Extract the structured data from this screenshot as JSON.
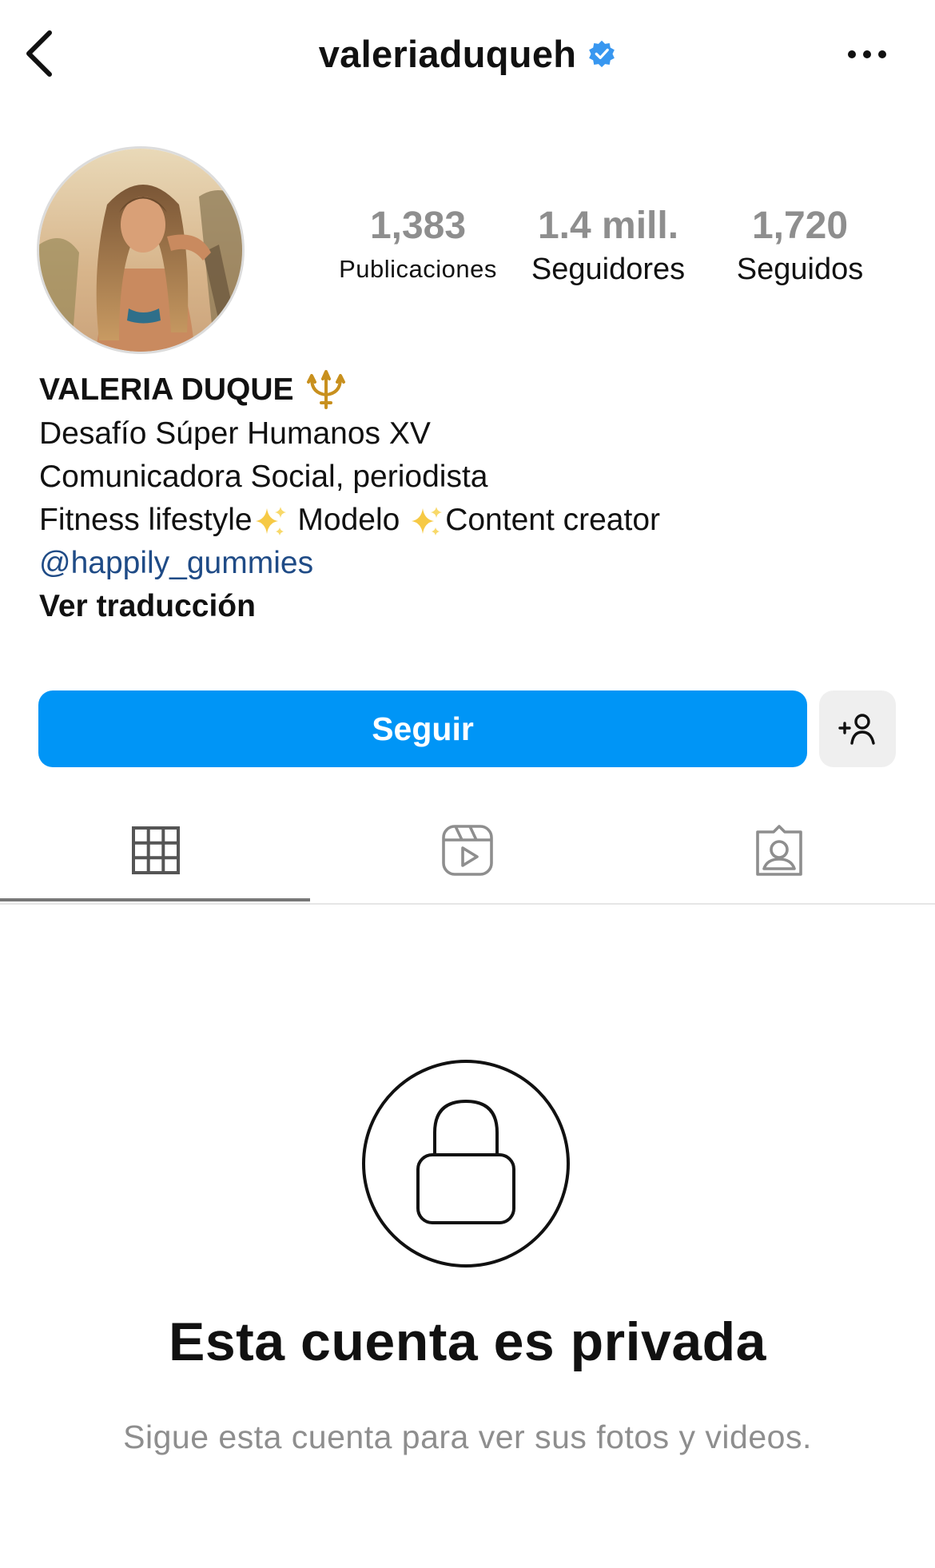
{
  "header": {
    "username": "valeriaduqueh",
    "back_icon": "chevron-left-icon",
    "verified_icon": "verified-badge-icon",
    "more_icon": "more-dots-icon"
  },
  "stats": {
    "posts": {
      "value": "1,383",
      "label": "Publicaciones"
    },
    "followers": {
      "value": "1.4 mill.",
      "label": "Seguidores"
    },
    "following": {
      "value": "1,720",
      "label": "Seguidos"
    }
  },
  "bio": {
    "name": "VALERIA DUQUE",
    "name_emoji": "trident-emoji",
    "line1": "Desafío Súper Humanos XV",
    "line2": "Comunicadora Social, periodista",
    "line3_a": "Fitness lifestyle",
    "line3_b": " Modelo ",
    "line3_c": "Content creator",
    "sparkle_icon": "sparkles-emoji",
    "mention": "@happily_gummies",
    "translate": "Ver traducción"
  },
  "actions": {
    "follow_label": "Seguir",
    "suggest_icon": "add-person-icon"
  },
  "tabs": [
    {
      "name": "grid",
      "icon": "grid-icon",
      "active": true
    },
    {
      "name": "reels",
      "icon": "reels-icon",
      "active": false
    },
    {
      "name": "tagged",
      "icon": "tagged-icon",
      "active": false
    }
  ],
  "private": {
    "icon": "lock-icon",
    "title": "Esta cuenta es privada",
    "subtitle": "Sigue esta cuenta para ver sus fotos y videos."
  },
  "colors": {
    "follow_button": "#0095f6",
    "verified": "#3897f0",
    "link": "#1f4b86",
    "muted": "#8e8e8e"
  }
}
